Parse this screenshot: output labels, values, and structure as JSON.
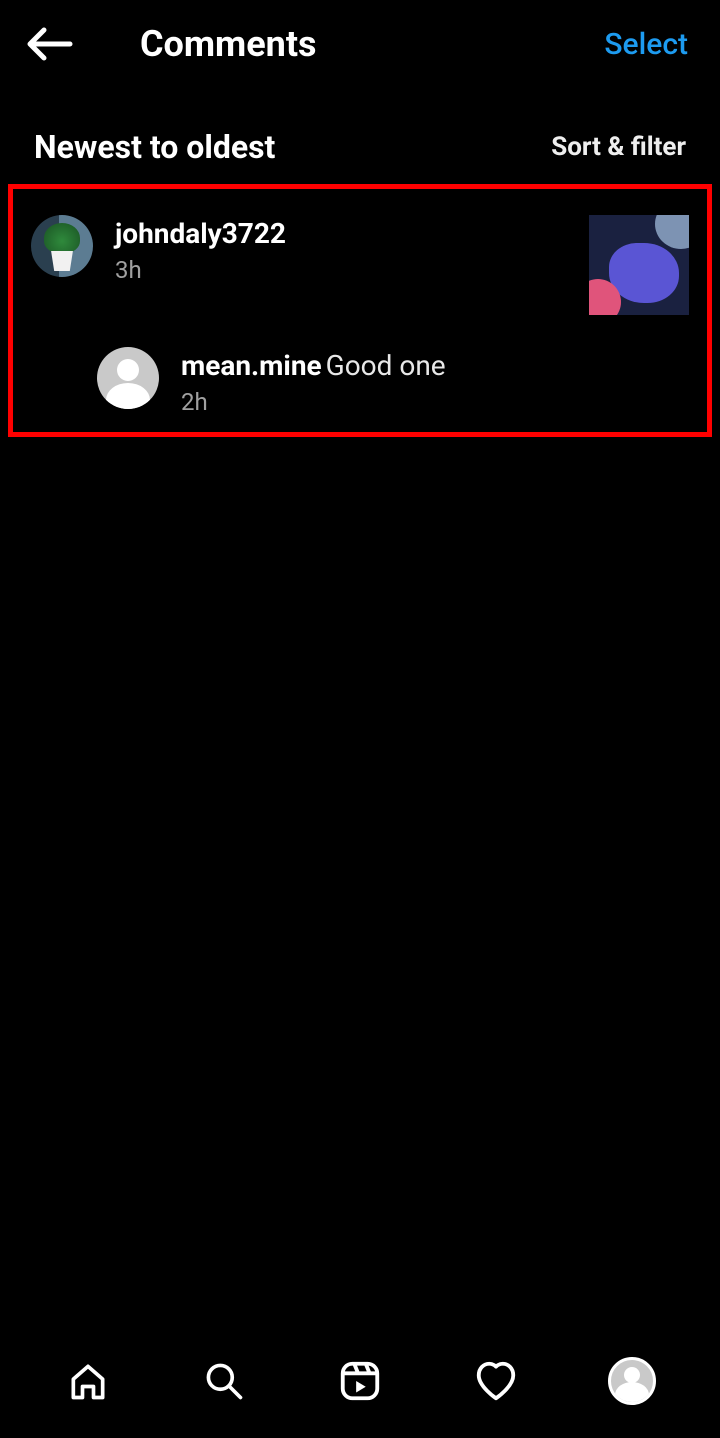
{
  "header": {
    "title": "Comments",
    "select_label": "Select"
  },
  "sort": {
    "label": "Newest to oldest",
    "filter_label": "Sort & filter"
  },
  "comments": [
    {
      "username": "johndaly3722",
      "text": "",
      "timestamp": "3h",
      "reply": {
        "username": "mean.mine",
        "text": "Good one",
        "timestamp": "2h"
      }
    }
  ],
  "colors": {
    "accent": "#1d9bf0",
    "highlight_border": "#ff0000"
  }
}
